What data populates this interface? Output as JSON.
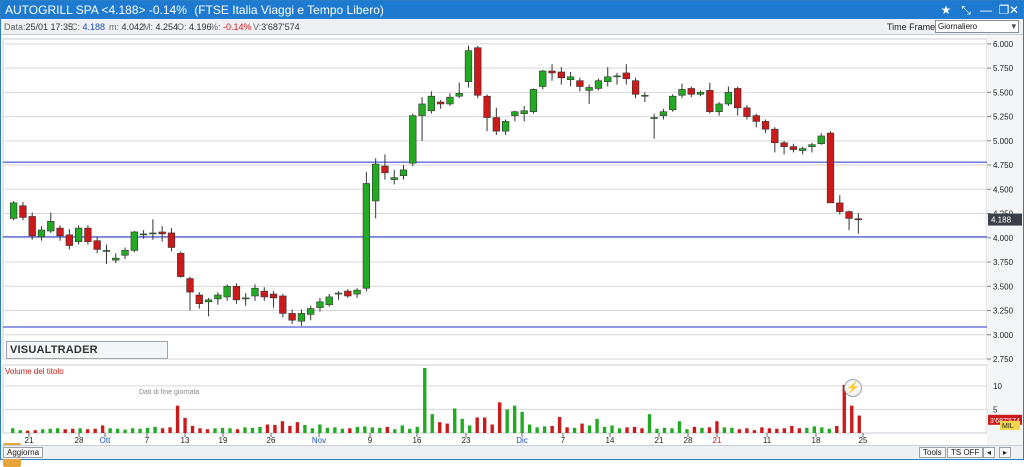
{
  "window": {
    "title": "AUTOGRILL SPA <4.188> -0.14%",
    "index_name": "(FTSE Italia Viaggi e Tempo Libero)",
    "controls": {
      "star": "★",
      "pin": "⤡",
      "min": "—",
      "restore": "❐",
      "close": "✕"
    }
  },
  "infobar": {
    "data_label": "Data:",
    "data_value": "25/01 17:35",
    "c_label": "C:",
    "c_value": "4.188",
    "m_label": "m:",
    "m_value": "4.042",
    "M_label": "M:",
    "M_value": "4.254",
    "o_label": "O:",
    "o_value": "4.196",
    "pct_label": "%:",
    "pct_value": "-0.14%",
    "v_label": "V:",
    "v_value": "3'687'574",
    "time_frame_label": "Time Frame",
    "time_frame_value": "Giornaliero"
  },
  "brand": {
    "name": "VISUALTRADER",
    "subtitle": "Dati di fine giornata"
  },
  "volume_panel_label": "Volume del titolo",
  "price_axis": [
    "6.000",
    "5.750",
    "5.500",
    "5.250",
    "5.000",
    "4.750",
    "4.500",
    "4.250",
    "4.000",
    "3.750",
    "3.500",
    "3.250",
    "3.000",
    "2.750"
  ],
  "current_price_tag": "4.188",
  "volume_axis": [
    "10",
    "5"
  ],
  "volume_tag": "3'687'574",
  "volume_tag_short": "MIL",
  "x_axis": [
    {
      "label": "21",
      "red": false
    },
    {
      "label": "28",
      "red": false
    },
    {
      "label": "Ott",
      "red": false,
      "blue": true
    },
    {
      "label": "7",
      "red": false
    },
    {
      "label": "13",
      "red": false
    },
    {
      "label": "19",
      "red": false
    },
    {
      "label": "26",
      "red": false
    },
    {
      "label": "Nov",
      "red": false,
      "blue": true
    },
    {
      "label": "9",
      "red": false
    },
    {
      "label": "16",
      "red": false
    },
    {
      "label": "23",
      "red": false
    },
    {
      "label": "Dic",
      "red": false,
      "blue": true
    },
    {
      "label": "7",
      "red": false
    },
    {
      "label": "14",
      "red": false
    },
    {
      "label": "21",
      "red": false
    },
    {
      "label": "28",
      "red": false
    },
    {
      "label": "21",
      "red": true
    },
    {
      "label": "11",
      "red": false
    },
    {
      "label": "18",
      "red": false
    },
    {
      "label": "25",
      "red": false
    }
  ],
  "statusbar": {
    "update": "Aggiorna",
    "tools": "Tools",
    "ts": "TS OFF",
    "prev": "◂",
    "next": "▸"
  },
  "colors": {
    "up": "#22aa22",
    "down": "#cc1a1a",
    "hline": "#2233cc",
    "grid": "#d7d7d7"
  },
  "chart_data": {
    "type": "candlestick",
    "ylim": [
      2.75,
      6.05
    ],
    "horizontal_levels": [
      4.78,
      4.01,
      3.08
    ],
    "candles": [
      {
        "o": 4.2,
        "h": 4.38,
        "l": 4.18,
        "c": 4.36
      },
      {
        "o": 4.33,
        "h": 4.37,
        "l": 4.18,
        "c": 4.21
      },
      {
        "o": 4.22,
        "h": 4.26,
        "l": 3.98,
        "c": 4.02
      },
      {
        "o": 4.01,
        "h": 4.12,
        "l": 3.97,
        "c": 4.08
      },
      {
        "o": 4.07,
        "h": 4.26,
        "l": 4.05,
        "c": 4.17
      },
      {
        "o": 4.1,
        "h": 4.13,
        "l": 3.97,
        "c": 4.02
      },
      {
        "o": 4.03,
        "h": 4.09,
        "l": 3.88,
        "c": 3.92
      },
      {
        "o": 3.96,
        "h": 4.13,
        "l": 3.93,
        "c": 4.1
      },
      {
        "o": 4.1,
        "h": 4.13,
        "l": 3.93,
        "c": 3.96
      },
      {
        "o": 3.97,
        "h": 4.01,
        "l": 3.84,
        "c": 3.88
      },
      {
        "o": 3.87,
        "h": 3.93,
        "l": 3.73,
        "c": 3.87
      },
      {
        "o": 3.77,
        "h": 3.84,
        "l": 3.74,
        "c": 3.79
      },
      {
        "o": 3.82,
        "h": 3.9,
        "l": 3.78,
        "c": 3.87
      },
      {
        "o": 3.87,
        "h": 4.07,
        "l": 3.85,
        "c": 4.06
      },
      {
        "o": 4.03,
        "h": 4.08,
        "l": 3.99,
        "c": 4.04
      },
      {
        "o": 4.04,
        "h": 4.19,
        "l": 3.98,
        "c": 4.05
      },
      {
        "o": 4.06,
        "h": 4.12,
        "l": 3.96,
        "c": 4.04
      },
      {
        "o": 4.05,
        "h": 4.1,
        "l": 3.86,
        "c": 3.9
      },
      {
        "o": 3.84,
        "h": 3.86,
        "l": 3.59,
        "c": 3.6
      },
      {
        "o": 3.58,
        "h": 3.6,
        "l": 3.25,
        "c": 3.44
      },
      {
        "o": 3.41,
        "h": 3.44,
        "l": 3.27,
        "c": 3.32
      },
      {
        "o": 3.34,
        "h": 3.38,
        "l": 3.19,
        "c": 3.36
      },
      {
        "o": 3.37,
        "h": 3.44,
        "l": 3.31,
        "c": 3.41
      },
      {
        "o": 3.39,
        "h": 3.52,
        "l": 3.35,
        "c": 3.5
      },
      {
        "o": 3.5,
        "h": 3.53,
        "l": 3.32,
        "c": 3.36
      },
      {
        "o": 3.37,
        "h": 3.43,
        "l": 3.3,
        "c": 3.38
      },
      {
        "o": 3.4,
        "h": 3.52,
        "l": 3.35,
        "c": 3.48
      },
      {
        "o": 3.45,
        "h": 3.49,
        "l": 3.35,
        "c": 3.39
      },
      {
        "o": 3.42,
        "h": 3.45,
        "l": 3.28,
        "c": 3.38
      },
      {
        "o": 3.4,
        "h": 3.42,
        "l": 3.18,
        "c": 3.22
      },
      {
        "o": 3.22,
        "h": 3.26,
        "l": 3.11,
        "c": 3.15
      },
      {
        "o": 3.14,
        "h": 3.26,
        "l": 3.09,
        "c": 3.22
      },
      {
        "o": 3.21,
        "h": 3.3,
        "l": 3.15,
        "c": 3.27
      },
      {
        "o": 3.28,
        "h": 3.38,
        "l": 3.24,
        "c": 3.34
      },
      {
        "o": 3.31,
        "h": 3.42,
        "l": 3.29,
        "c": 3.39
      },
      {
        "o": 3.42,
        "h": 3.45,
        "l": 3.36,
        "c": 3.43
      },
      {
        "o": 3.45,
        "h": 3.47,
        "l": 3.38,
        "c": 3.4
      },
      {
        "o": 3.42,
        "h": 3.48,
        "l": 3.38,
        "c": 3.46
      },
      {
        "o": 3.48,
        "h": 4.68,
        "l": 3.45,
        "c": 4.56
      },
      {
        "o": 4.38,
        "h": 4.82,
        "l": 4.2,
        "c": 4.76
      },
      {
        "o": 4.74,
        "h": 4.86,
        "l": 4.6,
        "c": 4.67
      },
      {
        "o": 4.6,
        "h": 4.7,
        "l": 4.55,
        "c": 4.62
      },
      {
        "o": 4.64,
        "h": 4.75,
        "l": 4.6,
        "c": 4.7
      },
      {
        "o": 4.77,
        "h": 5.28,
        "l": 4.74,
        "c": 5.26
      },
      {
        "o": 5.26,
        "h": 5.45,
        "l": 5.0,
        "c": 5.38
      },
      {
        "o": 5.31,
        "h": 5.51,
        "l": 5.28,
        "c": 5.46
      },
      {
        "o": 5.4,
        "h": 5.42,
        "l": 5.33,
        "c": 5.38
      },
      {
        "o": 5.38,
        "h": 5.49,
        "l": 5.36,
        "c": 5.45
      },
      {
        "o": 5.46,
        "h": 5.6,
        "l": 5.44,
        "c": 5.49
      },
      {
        "o": 5.61,
        "h": 5.98,
        "l": 5.55,
        "c": 5.93
      },
      {
        "o": 5.96,
        "h": 5.98,
        "l": 5.44,
        "c": 5.47
      },
      {
        "o": 5.46,
        "h": 5.48,
        "l": 5.1,
        "c": 5.24
      },
      {
        "o": 5.24,
        "h": 5.34,
        "l": 5.06,
        "c": 5.1
      },
      {
        "o": 5.1,
        "h": 5.22,
        "l": 5.06,
        "c": 5.2
      },
      {
        "o": 5.26,
        "h": 5.31,
        "l": 5.2,
        "c": 5.3
      },
      {
        "o": 5.28,
        "h": 5.36,
        "l": 5.2,
        "c": 5.31
      },
      {
        "o": 5.3,
        "h": 5.54,
        "l": 5.28,
        "c": 5.53
      },
      {
        "o": 5.56,
        "h": 5.73,
        "l": 5.53,
        "c": 5.72
      },
      {
        "o": 5.72,
        "h": 5.79,
        "l": 5.62,
        "c": 5.7
      },
      {
        "o": 5.71,
        "h": 5.76,
        "l": 5.58,
        "c": 5.65
      },
      {
        "o": 5.63,
        "h": 5.71,
        "l": 5.56,
        "c": 5.66
      },
      {
        "o": 5.62,
        "h": 5.65,
        "l": 5.51,
        "c": 5.56
      },
      {
        "o": 5.52,
        "h": 5.58,
        "l": 5.38,
        "c": 5.55
      },
      {
        "o": 5.54,
        "h": 5.64,
        "l": 5.52,
        "c": 5.62
      },
      {
        "o": 5.61,
        "h": 5.76,
        "l": 5.56,
        "c": 5.66
      },
      {
        "o": 5.66,
        "h": 5.7,
        "l": 5.58,
        "c": 5.67
      },
      {
        "o": 5.7,
        "h": 5.79,
        "l": 5.58,
        "c": 5.64
      },
      {
        "o": 5.62,
        "h": 5.65,
        "l": 5.44,
        "c": 5.48
      },
      {
        "o": 5.46,
        "h": 5.5,
        "l": 5.4,
        "c": 5.47
      },
      {
        "o": 5.24,
        "h": 5.28,
        "l": 5.02,
        "c": 5.24
      },
      {
        "o": 5.26,
        "h": 5.33,
        "l": 5.22,
        "c": 5.3
      },
      {
        "o": 5.32,
        "h": 5.48,
        "l": 5.3,
        "c": 5.46
      },
      {
        "o": 5.47,
        "h": 5.59,
        "l": 5.44,
        "c": 5.53
      },
      {
        "o": 5.54,
        "h": 5.56,
        "l": 5.45,
        "c": 5.48
      },
      {
        "o": 5.48,
        "h": 5.52,
        "l": 5.46,
        "c": 5.5
      },
      {
        "o": 5.52,
        "h": 5.6,
        "l": 5.28,
        "c": 5.3
      },
      {
        "o": 5.3,
        "h": 5.4,
        "l": 5.26,
        "c": 5.38
      },
      {
        "o": 5.38,
        "h": 5.56,
        "l": 5.36,
        "c": 5.5
      },
      {
        "o": 5.54,
        "h": 5.56,
        "l": 5.26,
        "c": 5.34
      },
      {
        "o": 5.34,
        "h": 5.37,
        "l": 5.22,
        "c": 5.25
      },
      {
        "o": 5.26,
        "h": 5.28,
        "l": 5.14,
        "c": 5.2
      },
      {
        "o": 5.2,
        "h": 5.22,
        "l": 5.08,
        "c": 5.12
      },
      {
        "o": 5.12,
        "h": 5.14,
        "l": 4.88,
        "c": 4.98
      },
      {
        "o": 4.98,
        "h": 5.0,
        "l": 4.86,
        "c": 4.94
      },
      {
        "o": 4.94,
        "h": 4.97,
        "l": 4.88,
        "c": 4.91
      },
      {
        "o": 4.9,
        "h": 4.94,
        "l": 4.86,
        "c": 4.92
      },
      {
        "o": 4.94,
        "h": 4.98,
        "l": 4.88,
        "c": 4.96
      },
      {
        "o": 4.97,
        "h": 5.08,
        "l": 4.96,
        "c": 5.05
      },
      {
        "o": 5.08,
        "h": 5.1,
        "l": 4.36,
        "c": 4.36
      },
      {
        "o": 4.36,
        "h": 4.44,
        "l": 4.24,
        "c": 4.27
      },
      {
        "o": 4.27,
        "h": 4.28,
        "l": 4.08,
        "c": 4.2
      },
      {
        "o": 4.196,
        "h": 4.254,
        "l": 4.042,
        "c": 4.188
      }
    ],
    "volumes": [
      1.0,
      0.6,
      0.5,
      0.6,
      0.8,
      0.9,
      1.0,
      0.8,
      0.9,
      1.0,
      0.8,
      0.9,
      1.6,
      1.0,
      0.9,
      0.7,
      1.0,
      0.9,
      1.1,
      1.3,
      1.0,
      1.2,
      5.8,
      3.2,
      1.5,
      1.0,
      0.8,
      1.0,
      1.1,
      1.0,
      0.8,
      1.2,
      1.1,
      1.3,
      1.8,
      1.7,
      2.5,
      1.5,
      2.3,
      1.7,
      1.0,
      1.8,
      1.1,
      1.2,
      0.9,
      1.0,
      1.3,
      1.4,
      1.2,
      1.1,
      1.3,
      0.8,
      1.6,
      0.9,
      1.3,
      13.8,
      4.0,
      2.3,
      2.0,
      5.2,
      3.0,
      1.6,
      3.3,
      3.3,
      1.8,
      6.5,
      5.0,
      5.8,
      4.5,
      1.8,
      1.2,
      1.4,
      1.5,
      3.4,
      1.2,
      1.1,
      2.0,
      1.6,
      3.0,
      1.3,
      1.6,
      1.0,
      1.2,
      1.3,
      1.0,
      4.0,
      0.9,
      1.1,
      1.0,
      2.5,
      0.8,
      1.3,
      1.1,
      1.2,
      2.5,
      1.2,
      1.1,
      0.8,
      1.0,
      0.6,
      1.2,
      1.0,
      0.9,
      1.0,
      1.5,
      1.0,
      1.1,
      1.4,
      1.2,
      0.9,
      1.5,
      10.2,
      5.8,
      3.7
    ]
  }
}
